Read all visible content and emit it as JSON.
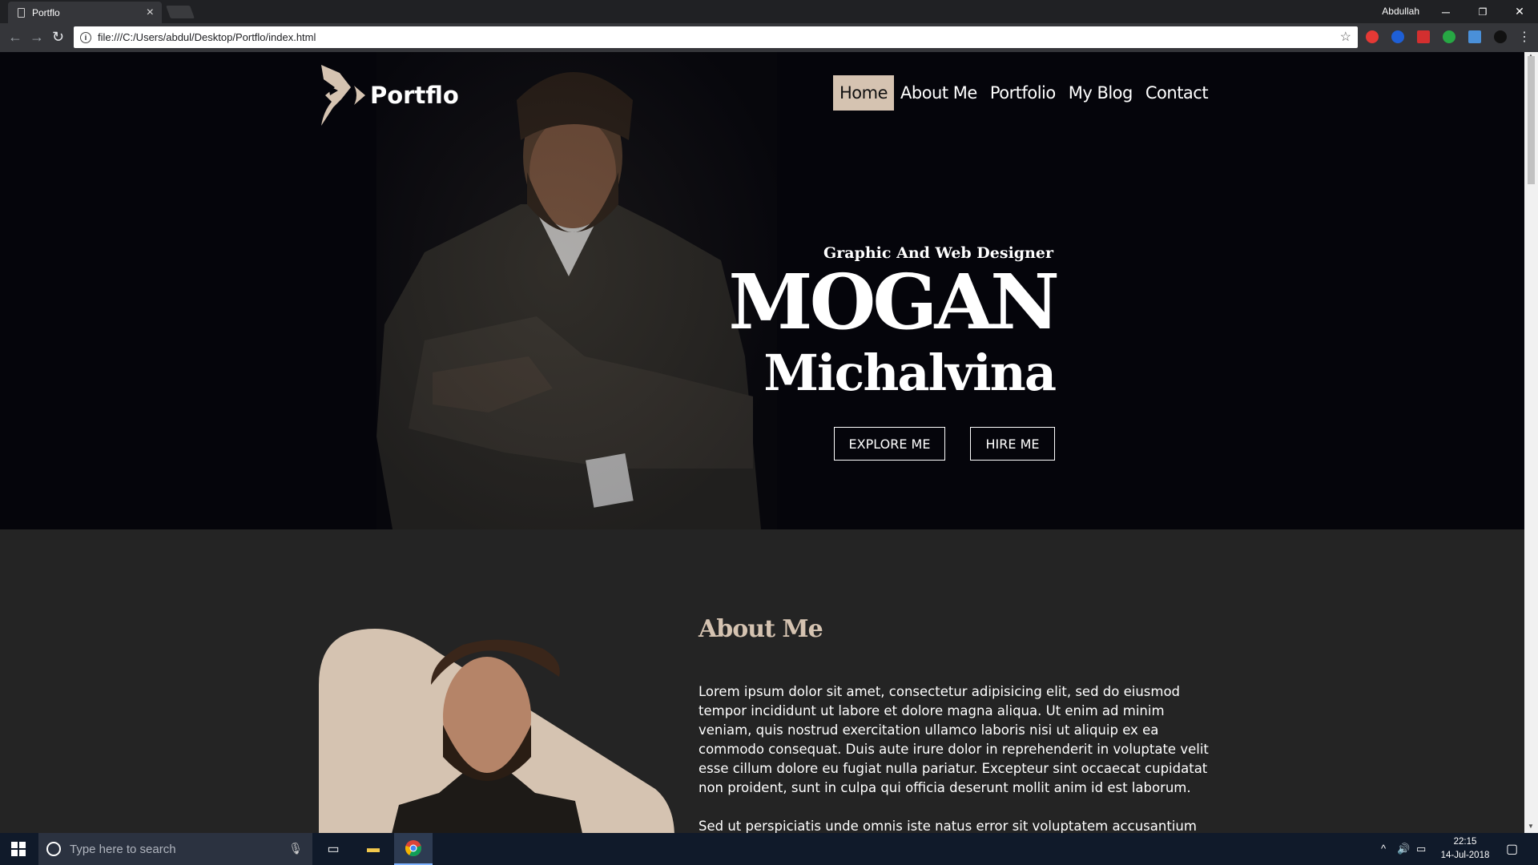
{
  "browser": {
    "tab_title": "Portflo",
    "tab_close": "×",
    "user": "Abdullah",
    "url": "file:///C:/Users/abdul/Desktop/Portflo/index.html",
    "window_buttons": {
      "minimize": "─",
      "restore": "❐",
      "close": "✕"
    }
  },
  "site": {
    "logo_text": "Portflo",
    "nav": [
      {
        "label": "Home",
        "active": true
      },
      {
        "label": "About Me",
        "active": false
      },
      {
        "label": "Portfolio",
        "active": false
      },
      {
        "label": "My Blog",
        "active": false
      },
      {
        "label": "Contact",
        "active": false
      }
    ],
    "hero": {
      "subtitle": "Graphic And Web Designer",
      "name_line1": "MOGAN",
      "name_line2": "Michalvina",
      "buttons": [
        "EXPLORE ME",
        "HIRE ME"
      ]
    },
    "about": {
      "title": "About Me",
      "paragraph1": "Lorem ipsum dolor sit amet, consectetur adipisicing elit, sed do eiusmod tempor incididunt ut labore et dolore magna aliqua. Ut enim ad minim veniam, quis nostrud exercitation ullamco laboris nisi ut aliquip ex ea commodo consequat. Duis aute irure dolor in reprehenderit in voluptate velit esse cillum dolore eu fugiat nulla pariatur. Excepteur sint occaecat cupidatat non proident, sunt in culpa qui officia deserunt mollit anim id est laborum.",
      "paragraph2": "Sed ut perspiciatis unde omnis iste natus error sit voluptatem accusantium"
    },
    "colors": {
      "accent": "#d5c3b1",
      "hero_bg": "#05050b",
      "section_bg": "#242424"
    }
  },
  "taskbar": {
    "search_placeholder": "Type here to search",
    "time": "22:15",
    "date": "14-Jul-2018"
  }
}
